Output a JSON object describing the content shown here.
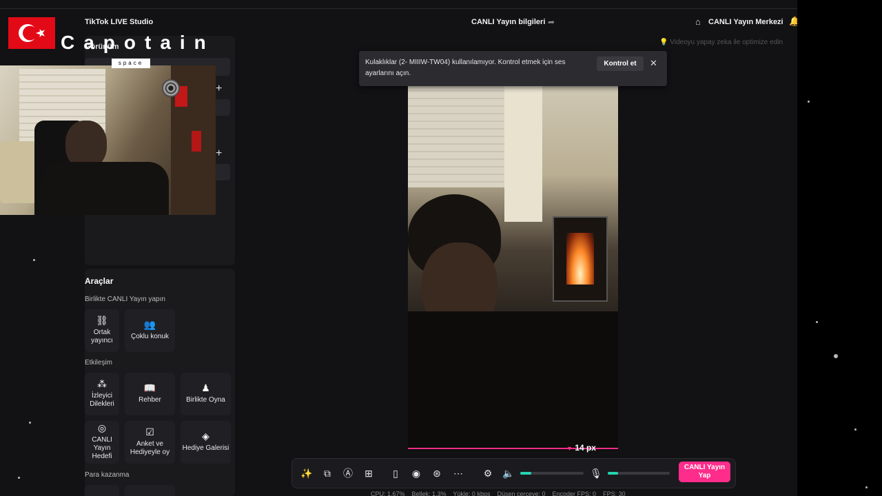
{
  "app": {
    "title": "TikTok LIVE Studio",
    "center_title": "CANLI Yayın bilgileri",
    "live_center": "CANLI Yayın Merkezi"
  },
  "overlay": {
    "brand": "Capotain",
    "space_label": "space"
  },
  "sidebar": {
    "scene_header": "Görünüm",
    "ai_hint": "Videoyu yapay zeka ile optimize edin",
    "tools_header": "Araçlar",
    "together_section": "Birlikte CANLI Yayın yapın",
    "interaction_section": "Etkileşim",
    "earn_section": "Para kazanma",
    "together_items": [
      {
        "label": "Ortak yayıncı",
        "icon": "link-icon"
      },
      {
        "label": "Çoklu konuk",
        "icon": "users-icon"
      }
    ],
    "interaction_items": [
      {
        "label": "İzleyici Dilekleri",
        "icon": "wish-icon"
      },
      {
        "label": "Rehber",
        "icon": "guide-icon"
      },
      {
        "label": "Birlikte Oyna",
        "icon": "play-together-icon"
      },
      {
        "label": "CANLI Yayın Hedefi",
        "icon": "goal-icon"
      },
      {
        "label": "Anket ve Hediyeyle oy",
        "icon": "poll-icon"
      },
      {
        "label": "Hediye Galerisi",
        "icon": "gift-gallery-icon"
      }
    ]
  },
  "toast": {
    "message": "Kulaklıklar (2- MIIIW-TW04) kullanılamıyor. Kontrol etmek için ses ayarlarını açın.",
    "action": "Kontrol et"
  },
  "preview": {
    "px_label": "14 px"
  },
  "toolbar": {
    "go_live": "CANLI Yayın Yap",
    "speaker_level": 0.17,
    "mic_level": 0.17
  },
  "stats": {
    "cpu": "CPU: 1.67%",
    "memory": "Bellek: 1.3%",
    "upload": "Yükle: 0 kbps",
    "dropped": "Düşen çerçeve: 0",
    "encoder_fps": "Encoder FPS: 0",
    "fps": "FPS: 30"
  },
  "colors": {
    "accent": "#fe2c8a",
    "level": "#25d4b0",
    "bg": "#121214"
  }
}
